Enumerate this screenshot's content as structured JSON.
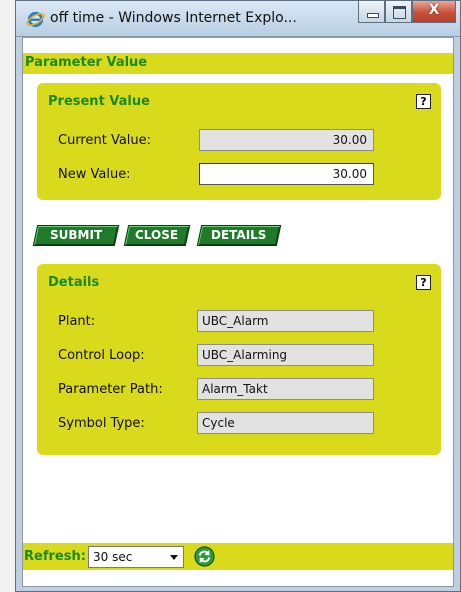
{
  "window": {
    "title": "off time - Windows Internet Explo...",
    "icon": "ie-icon",
    "controls": {
      "minimize": "minimize-icon",
      "maximize": "maximize-icon",
      "close_glyph": "X"
    }
  },
  "page": {
    "title": "Parameter Value"
  },
  "present_value": {
    "title": "Present Value",
    "help": "?",
    "current_label": "Current Value:",
    "current_value": "30.00",
    "new_label": "New Value:",
    "new_value": "30.00"
  },
  "buttons": {
    "submit": "SUBMIT",
    "close": "CLOSE",
    "details": "DETAILS"
  },
  "details": {
    "title": "Details",
    "help": "?",
    "rows": [
      {
        "label": "Plant:",
        "value": "UBC_Alarm"
      },
      {
        "label": "Control Loop:",
        "value": "UBC_Alarming"
      },
      {
        "label": "Parameter Path:",
        "value": "Alarm_Takt"
      },
      {
        "label": "Symbol Type:",
        "value": "Cycle"
      }
    ]
  },
  "refresh": {
    "label": "Refresh:",
    "selected": "30 sec",
    "icon": "refresh-icon"
  },
  "colors": {
    "panel": "#dada1c",
    "heading_green": "#1a8a20",
    "button_green": "#1f7a2a"
  }
}
